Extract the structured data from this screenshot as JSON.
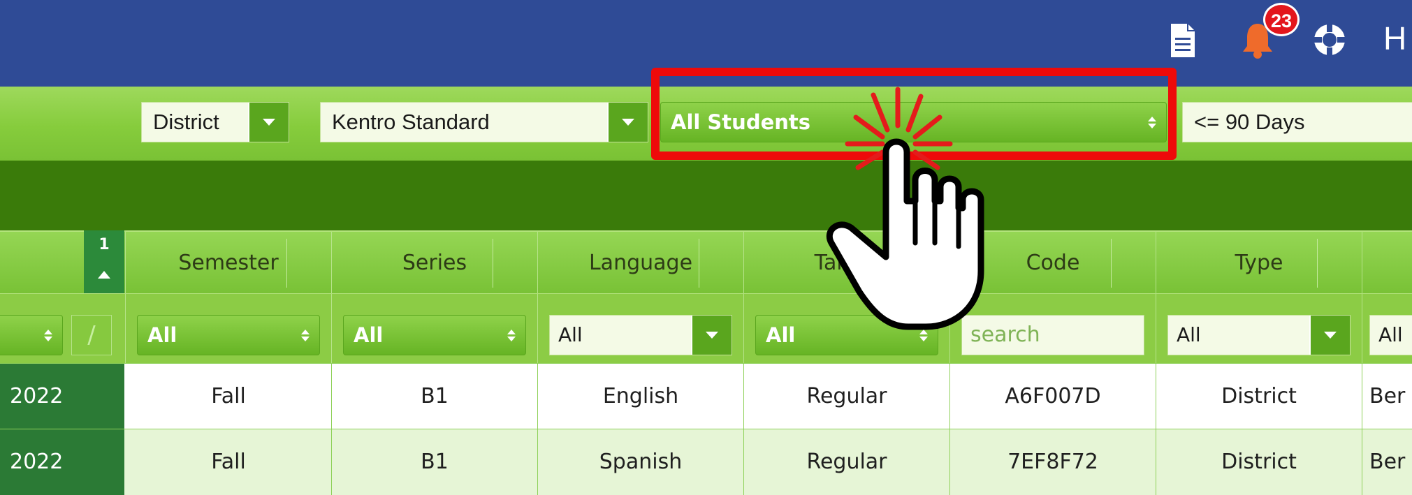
{
  "header": {
    "user_initial": "H",
    "notification_count": "23",
    "icons": [
      "document-icon",
      "bell-icon",
      "help-lifebuoy-icon"
    ]
  },
  "filters": {
    "scope": "District",
    "standard": "Kentro Standard",
    "students": "All Students",
    "period": "<= 90 Days"
  },
  "columns": {
    "sort_index": "1",
    "headers": [
      "Semester",
      "Series",
      "Language",
      "Target",
      "Code",
      "Type"
    ]
  },
  "column_filters": {
    "semester": "All",
    "series": "All",
    "language": "All",
    "target": "All",
    "code_placeholder": "search",
    "type": "All",
    "last": "All",
    "slash": "/"
  },
  "rows": [
    {
      "year": "2022",
      "semester": "Fall",
      "series": "B1",
      "language": "English",
      "target": "Regular",
      "code": "A6F007D",
      "type": "District",
      "last": "Ber"
    },
    {
      "year": "2022",
      "semester": "Fall",
      "series": "B1",
      "language": "Spanish",
      "target": "Regular",
      "code": "7EF8F72",
      "type": "District",
      "last": "Ber"
    }
  ],
  "colors": {
    "header_bg": "#2f4b96",
    "accent_green": "#7ac235",
    "dark_band": "#3a7b0a",
    "highlight": "#ee0a0a"
  }
}
